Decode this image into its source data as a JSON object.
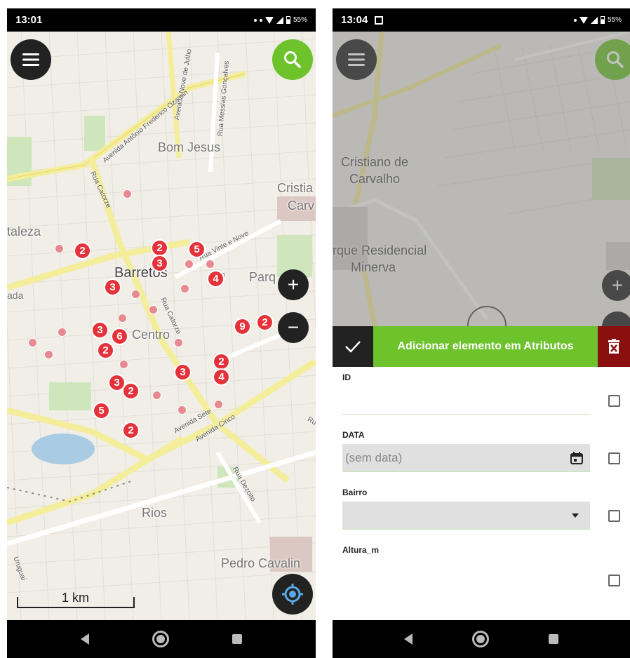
{
  "left_screen": {
    "status_time": "13:01",
    "battery": "55%",
    "menu_icon": "hamburger-menu-icon",
    "search_icon": "search-icon",
    "zoom_in": "+",
    "zoom_out": "−",
    "locate_icon": "gps-locate-icon",
    "scale_label": "1 km",
    "places": {
      "bom_jesus": "Bom Jesus",
      "barretos": "Barretos",
      "centro": "Centro",
      "rios": "Rios",
      "pedro_cavalin": "Pedro Cavalin",
      "cristia": "Cristia",
      "carv": "Carv",
      "parq": "Parq",
      "taleza": "taleza",
      "ada": "ada"
    },
    "streets": {
      "av_antonio_frederico_ozanan": "Avenida Antônio Frederico Ozanan",
      "av_nove_de_julho": "Avenida Nove de Julho",
      "rua_messias_goncalves": "Rua Messias Gonçalves",
      "rua_catorze": "Rua Catorze",
      "rua_catorze_2": "Rua Catorze",
      "rua_vinte_e_nove": "Rua Vinte e Nove",
      "av_sete": "Avenida Sete",
      "av_cinco": "Avenida Cinco",
      "rua_dezoito": "Rua Dezoito",
      "rua_uruguai": "Uruguai",
      "rua_ro": "Ru",
      "rua_b": "Ru",
      "rua_ru": "Ru"
    },
    "clusters": [
      "2",
      "2",
      "3",
      "5",
      "3",
      "4",
      "3",
      "6",
      "2",
      "9",
      "2",
      "2",
      "3",
      "4",
      "3",
      "2",
      "5",
      "2"
    ]
  },
  "right_screen": {
    "status_time": "13:04",
    "battery": "55%",
    "places": {
      "cristiano": "Cristiano de",
      "carvalho": "Carvalho",
      "parque": "rque Residencial",
      "minerva": "Minerva"
    },
    "zoom_in": "+",
    "action_title": "Adicionar elemento em Atributos",
    "confirm_icon": "checkmark-icon",
    "delete_icon": "delete-icon",
    "fields": {
      "id": {
        "label": "ID",
        "value": ""
      },
      "data": {
        "label": "DATA",
        "value": "(sem data)"
      },
      "bairro": {
        "label": "Bairro",
        "value": ""
      },
      "altura": {
        "label": "Altura_m",
        "value": ""
      }
    }
  }
}
